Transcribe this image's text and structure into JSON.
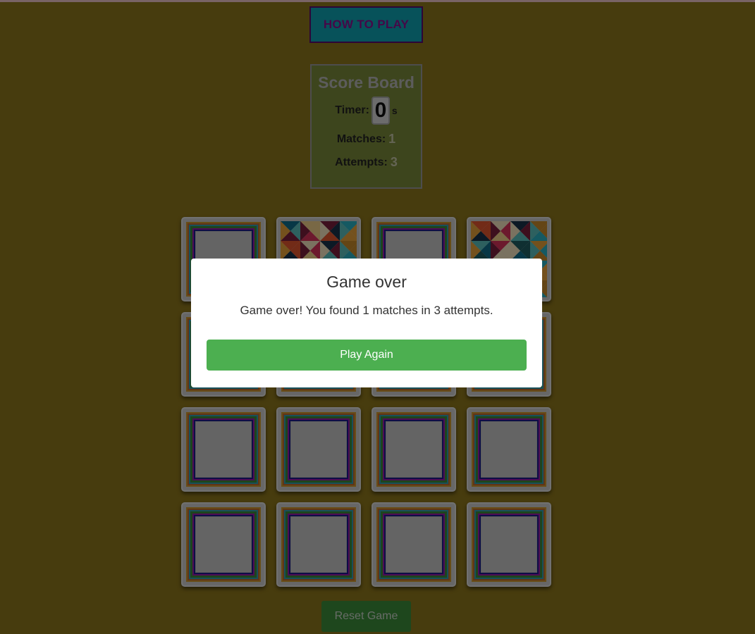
{
  "header": {
    "how_to_play_label": "HOW TO PLAY"
  },
  "scoreboard": {
    "title": "Score Board",
    "timer_label": "Timer:",
    "timer_value": "0",
    "timer_unit": "s",
    "matches_label": "Matches:",
    "matches_value": "1",
    "attempts_label": "Attempts:",
    "attempts_value": "3"
  },
  "board": {
    "rows": 4,
    "cols": 4,
    "cards": [
      {
        "state": "face-down"
      },
      {
        "state": "face-up",
        "pattern": "geometric-triangles"
      },
      {
        "state": "face-down"
      },
      {
        "state": "face-up",
        "pattern": "geometric-triangles"
      },
      {
        "state": "face-down"
      },
      {
        "state": "face-down"
      },
      {
        "state": "face-down"
      },
      {
        "state": "face-down"
      },
      {
        "state": "face-down"
      },
      {
        "state": "face-down"
      },
      {
        "state": "face-down"
      },
      {
        "state": "face-down"
      },
      {
        "state": "face-down"
      },
      {
        "state": "face-down"
      },
      {
        "state": "face-down"
      },
      {
        "state": "face-down"
      }
    ]
  },
  "reset_label": "Reset Game",
  "modal": {
    "title": "Game over",
    "message": "Game over! You found 1 matches in 3 attempts.",
    "play_again_label": "Play Again"
  },
  "colors": {
    "page_bg": "#8f781c",
    "how_to_play_bg": "#0fa5b4",
    "scoreboard_bg": "#7b8a3a",
    "play_again_bg": "#4caf50",
    "reset_bg": "#3d8e3a"
  }
}
